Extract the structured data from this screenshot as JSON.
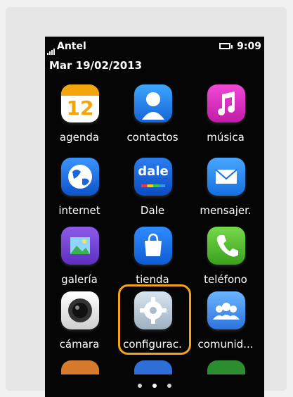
{
  "status": {
    "carrier": "Antel",
    "time": "9:09",
    "date": "Mar 19/02/2013"
  },
  "apps": [
    {
      "name": "agenda",
      "icon": "calendar-icon",
      "day": "12"
    },
    {
      "name": "contactos",
      "icon": "contacts-icon"
    },
    {
      "name": "música",
      "icon": "music-icon"
    },
    {
      "name": "internet",
      "icon": "globe-icon"
    },
    {
      "name": "Dale",
      "icon": "dale-icon",
      "icon_text": "dale"
    },
    {
      "name": "mensajer.",
      "icon": "messages-icon"
    },
    {
      "name": "galería",
      "icon": "gallery-icon"
    },
    {
      "name": "tienda",
      "icon": "store-icon"
    },
    {
      "name": "teléfono",
      "icon": "phone-icon"
    },
    {
      "name": "cámara",
      "icon": "camera-icon"
    },
    {
      "name": "configurac.",
      "icon": "settings-icon",
      "highlighted": true
    },
    {
      "name": "comunid...",
      "icon": "community-icon"
    }
  ],
  "pager": {
    "pages": 3,
    "active": 2
  },
  "colors": {
    "highlight": "#f5a316",
    "screen_bg": "#050505"
  }
}
